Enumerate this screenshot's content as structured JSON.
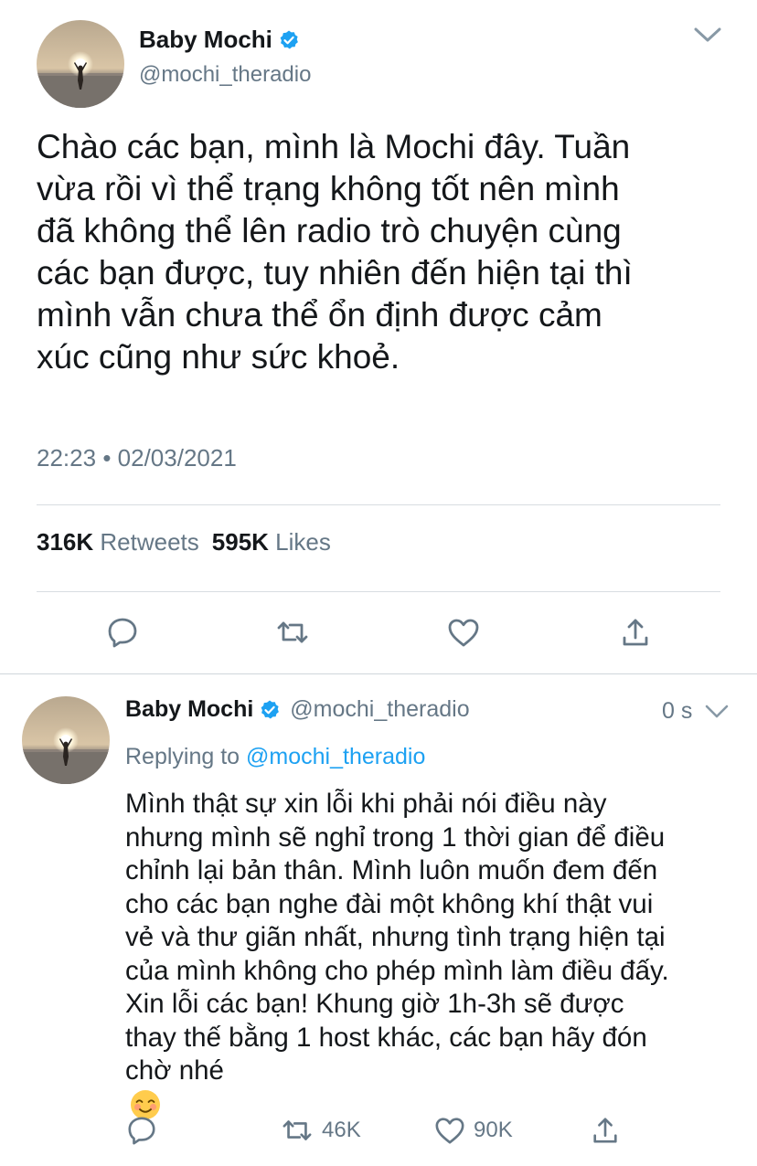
{
  "main_tweet": {
    "display_name": "Baby Mochi",
    "handle": "@mochi_theradio",
    "text_lines": [
      "Chào các bạn, mình là Mochi đây. Tuần",
      "vừa rồi vì thể trạng không tốt nên mình",
      "đã không thể lên radio trò chuyện cùng",
      "các bạn được, tuy nhiên đến hiện tại thì",
      "mình vẫn chưa thể ổn định được cảm",
      "xúc cũng như sức khoẻ."
    ],
    "time": "22:23",
    "separator": "•",
    "date": "02/03/2021",
    "retweets_count": "316K",
    "retweets_label": "Retweets",
    "likes_count": "595K",
    "likes_label": "Likes",
    "icons": {
      "verified": "verified-badge-icon",
      "more": "chevron-down-icon",
      "reply": "reply-icon",
      "retweet": "retweet-icon",
      "like": "heart-icon",
      "share": "share-icon"
    }
  },
  "reply_tweet": {
    "display_name": "Baby Mochi",
    "handle": "@mochi_theradio",
    "time_ago": "0 s",
    "replying_prefix": "Replying to",
    "replying_to": "@mochi_theradio",
    "text_lines": [
      "Mình thật sự xin lỗi khi phải nói điều này",
      "nhưng mình sẽ nghỉ trong 1 thời gian để điều",
      "chỉnh lại bản thân. Mình luôn muốn đem đến",
      "cho các bạn nghe đài một không khí thật vui",
      "vẻ và thư giãn nhất, nhưng tình trạng hiện tại",
      "của mình không cho phép mình làm điều đấy.",
      "Xin lỗi các bạn! Khung giờ 1h-3h sẽ được",
      "thay thế bằng 1 host khác, các bạn hãy đón",
      "chờ nhé"
    ],
    "emoji": "smiling-face-icon",
    "retweet_count": "46K",
    "like_count": "90K"
  },
  "colors": {
    "text": "#14171a",
    "secondary": "#657786",
    "link": "#1da1f2",
    "divider": "#d8dde1"
  }
}
